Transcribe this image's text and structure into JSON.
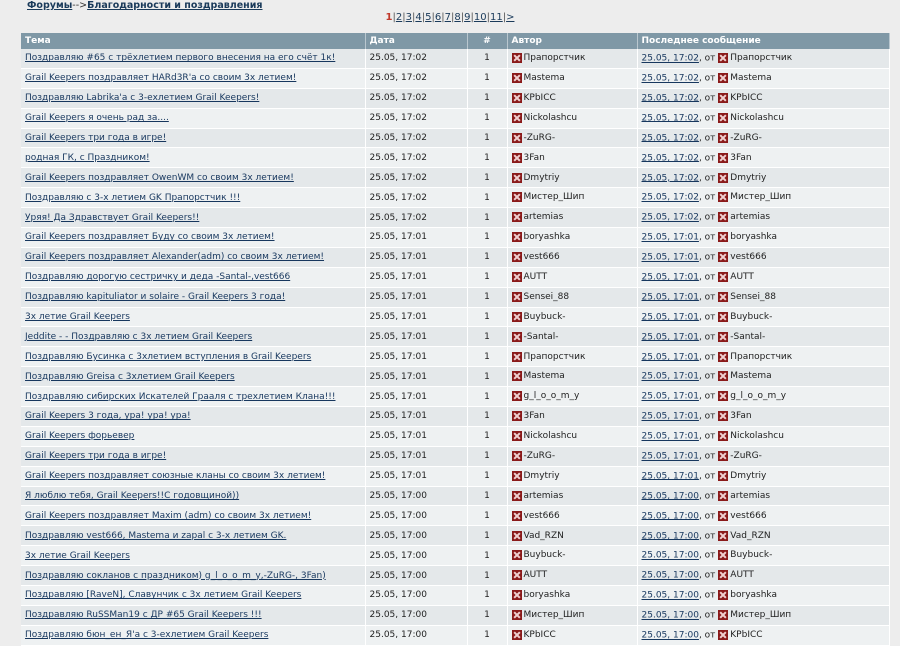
{
  "breadcrumb": {
    "forums": "Форумы",
    "separator": "-->",
    "current": "Благодарности и поздравления"
  },
  "pagination": {
    "current": "1",
    "pages": [
      "2",
      "3",
      "4",
      "5",
      "6",
      "7",
      "8",
      "9",
      "10",
      "11"
    ],
    "next": ">"
  },
  "table": {
    "headers": {
      "topic": "Тема",
      "date": "Дата",
      "count": "#",
      "author": "Автор",
      "last": "Последнее сообщение"
    },
    "last_prefix": ", от ",
    "rows": [
      {
        "topic": "Поздравляю #65 с трёхлетием первого внесения на его счёт 1к!",
        "date": "25.05, 17:02",
        "count": "1",
        "author": "Прапорстчик",
        "last_date": "25.05, 17:02",
        "last_author": "Прапорстчик"
      },
      {
        "topic": "Grail Keepers поздравляет HARd3R'a со своим 3х летием!",
        "date": "25.05, 17:02",
        "count": "1",
        "author": "Mastema",
        "last_date": "25.05, 17:02",
        "last_author": "Mastema"
      },
      {
        "topic": "Поздравляю Labrika'а с 3-ехлетием Grail Keepers!",
        "date": "25.05, 17:02",
        "count": "1",
        "author": "KPbICC",
        "last_date": "25.05, 17:02",
        "last_author": "KPbICC"
      },
      {
        "topic": "Grail Keepers я очень рад за....",
        "date": "25.05, 17:02",
        "count": "1",
        "author": "Nickolashcu",
        "last_date": "25.05, 17:02",
        "last_author": "Nickolashcu"
      },
      {
        "topic": "Grail Keepers три года в игре!",
        "date": "25.05, 17:02",
        "count": "1",
        "author": "-ZuRG-",
        "last_date": "25.05, 17:02",
        "last_author": "-ZuRG-"
      },
      {
        "topic": "родная ГК, с Праздником!",
        "date": "25.05, 17:02",
        "count": "1",
        "author": "3Fan",
        "last_date": "25.05, 17:02",
        "last_author": "3Fan"
      },
      {
        "topic": "Grail Keepers поздравляет OwenWM со своим 3х летием!",
        "date": "25.05, 17:02",
        "count": "1",
        "author": "Dmytriy",
        "last_date": "25.05, 17:02",
        "last_author": "Dmytriy"
      },
      {
        "topic": "Поздравляю с 3-х летием GK Прапорстчик !!!",
        "date": "25.05, 17:02",
        "count": "1",
        "author": "Мистер_Шип",
        "last_date": "25.05, 17:02",
        "last_author": "Мистер_Шип"
      },
      {
        "topic": "Уряя! Да Здравствует Grail Keepers!!",
        "date": "25.05, 17:02",
        "count": "1",
        "author": "artemias",
        "last_date": "25.05, 17:02",
        "last_author": "artemias"
      },
      {
        "topic": "Grail Keepers поздравляет Буду со своим 3х летием!",
        "date": "25.05, 17:01",
        "count": "1",
        "author": "boryashka",
        "last_date": "25.05, 17:01",
        "last_author": "boryashka"
      },
      {
        "topic": "Grail Keepers поздравляет Alexander(adm) со своим 3х летием!",
        "date": "25.05, 17:01",
        "count": "1",
        "author": "vest666",
        "last_date": "25.05, 17:01",
        "last_author": "vest666"
      },
      {
        "topic": "Поздравляю дорогую сестричку и деда -Santal-,vest666",
        "date": "25.05, 17:01",
        "count": "1",
        "author": "AUTT",
        "last_date": "25.05, 17:01",
        "last_author": "AUTT"
      },
      {
        "topic": "Поздравляю kapituliator и solaire - Grail Keepers 3 года!",
        "date": "25.05, 17:01",
        "count": "1",
        "author": "Sensei_88",
        "last_date": "25.05, 17:01",
        "last_author": "Sensei_88"
      },
      {
        "topic": "3х летие Grail Keepers",
        "date": "25.05, 17:01",
        "count": "1",
        "author": "Buybuck-",
        "last_date": "25.05, 17:01",
        "last_author": "Buybuck-"
      },
      {
        "topic": "Jeddite - - Поздравляю с 3х летием Grail Keepers",
        "date": "25.05, 17:01",
        "count": "1",
        "author": "-Santal-",
        "last_date": "25.05, 17:01",
        "last_author": "-Santal-"
      },
      {
        "topic": "Поздравляю Бусинка с 3хлетием вступления в Grail Keepers",
        "date": "25.05, 17:01",
        "count": "1",
        "author": "Прапорстчик",
        "last_date": "25.05, 17:01",
        "last_author": "Прапорстчик"
      },
      {
        "topic": "Поздравляю Greisa с 3хлетием Grail Keepers",
        "date": "25.05, 17:01",
        "count": "1",
        "author": "Mastema",
        "last_date": "25.05, 17:01",
        "last_author": "Mastema"
      },
      {
        "topic": "Поздравляю сибирских Искателей Грааля с трехлетием Клана!!!",
        "date": "25.05, 17:01",
        "count": "1",
        "author": "g_l_o_o_m_y",
        "last_date": "25.05, 17:01",
        "last_author": "g_l_o_o_m_y"
      },
      {
        "topic": "Grail Keepers 3 года, ура! ура! ура!",
        "date": "25.05, 17:01",
        "count": "1",
        "author": "3Fan",
        "last_date": "25.05, 17:01",
        "last_author": "3Fan"
      },
      {
        "topic": "Grail Keepers форьевер",
        "date": "25.05, 17:01",
        "count": "1",
        "author": "Nickolashcu",
        "last_date": "25.05, 17:01",
        "last_author": "Nickolashcu"
      },
      {
        "topic": "Grail Keepers три года в игре!",
        "date": "25.05, 17:01",
        "count": "1",
        "author": "-ZuRG-",
        "last_date": "25.05, 17:01",
        "last_author": "-ZuRG-"
      },
      {
        "topic": "Grail Keepers поздравляет союзные кланы со своим 3х летием!",
        "date": "25.05, 17:01",
        "count": "1",
        "author": "Dmytriy",
        "last_date": "25.05, 17:01",
        "last_author": "Dmytriy"
      },
      {
        "topic": "Я люблю тебя, Grail Keepers!!С годовщиной))",
        "date": "25.05, 17:00",
        "count": "1",
        "author": "artemias",
        "last_date": "25.05, 17:00",
        "last_author": "artemias"
      },
      {
        "topic": "Grail Keepers поздравляет Maxim (adm) со своим 3х летием!",
        "date": "25.05, 17:00",
        "count": "1",
        "author": "vest666",
        "last_date": "25.05, 17:00",
        "last_author": "vest666"
      },
      {
        "topic": "Поздравляю vest666, Mastema и zapal с 3-х летием GK.",
        "date": "25.05, 17:00",
        "count": "1",
        "author": "Vad_RZN",
        "last_date": "25.05, 17:00",
        "last_author": "Vad_RZN"
      },
      {
        "topic": "3х летие Grail Keepers",
        "date": "25.05, 17:00",
        "count": "1",
        "author": "Buybuck-",
        "last_date": "25.05, 17:00",
        "last_author": "Buybuck-"
      },
      {
        "topic": "Поздравляю сокланов с праздником) g_l_o_o_m_y,-ZuRG-, 3Fan)",
        "date": "25.05, 17:00",
        "count": "1",
        "author": "AUTT",
        "last_date": "25.05, 17:00",
        "last_author": "AUTT"
      },
      {
        "topic": "Поздравляю [RaveN], Славунчик с 3х летием Grail Keepers",
        "date": "25.05, 17:00",
        "count": "1",
        "author": "boryashka",
        "last_date": "25.05, 17:00",
        "last_author": "boryashka"
      },
      {
        "topic": "Поздравляю RuSSMan19 с ДР #65 Grail Keepers !!!",
        "date": "25.05, 17:00",
        "count": "1",
        "author": "Мистер_Шип",
        "last_date": "25.05, 17:00",
        "last_author": "Мистер_Шип"
      },
      {
        "topic": "Поздравляю бюн_ен_Я'а с 3-ехлетием Grail Keepers",
        "date": "25.05, 17:00",
        "count": "1",
        "author": "KPbICC",
        "last_date": "25.05, 17:00",
        "last_author": "KPbICC"
      }
    ]
  }
}
